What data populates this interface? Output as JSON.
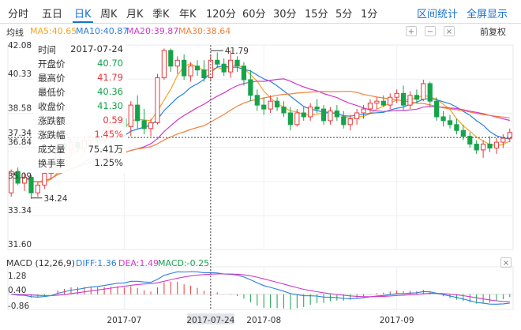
{
  "tabs": [
    {
      "label": "分时"
    },
    {
      "label": "五日"
    },
    {
      "label": "日K",
      "active": true
    },
    {
      "label": "周K"
    },
    {
      "label": "月K"
    },
    {
      "label": "季K"
    },
    {
      "label": "年K"
    },
    {
      "label": "120分"
    },
    {
      "label": "60分"
    },
    {
      "label": "30分"
    },
    {
      "label": "15分"
    },
    {
      "label": "5分"
    },
    {
      "label": "1分"
    }
  ],
  "toolbar": {
    "range_stats": "区间统计",
    "fullscreen": "全屏显示",
    "restore": "前复权"
  },
  "ma_legend": {
    "label": "均线",
    "ma5": "MA5:40.65",
    "ma10": "MA10:40.87",
    "ma20": "MA20:39.87",
    "ma30": "MA30:38.64"
  },
  "macd_legend": {
    "label": "MACD (12,26,9)",
    "diff": "DIFF:1.36",
    "dea": "DEA:1.49",
    "macd": "MACD:-0.25"
  },
  "controls": {
    "expand": "+",
    "collapse": "−",
    "close": "×"
  },
  "tooltip": {
    "rows": [
      {
        "label": "时间",
        "value": "2017-07-24"
      },
      {
        "label": "开盘价",
        "value": "40.70"
      },
      {
        "label": "最高价",
        "value": "41.79"
      },
      {
        "label": "最低价",
        "value": "40.36"
      },
      {
        "label": "收盘价",
        "value": "41.30"
      },
      {
        "label": "涨跌额",
        "value": "0.59"
      },
      {
        "label": "涨跌幅",
        "value": "1.45%"
      },
      {
        "label": "成交量",
        "value": "75.41万"
      },
      {
        "label": "换手率",
        "value": "1.25%"
      }
    ]
  },
  "colors": {
    "up": "#e4393c",
    "down": "#16a34a",
    "ma5": "#f5a623",
    "ma10": "#2a7fdc",
    "ma20": "#d13ac8",
    "ma30": "#f47f3b",
    "diff": "#2a7fdc",
    "dea": "#d13ac8",
    "accent": "#1a6fd1"
  },
  "chart_data": {
    "type": "candlestick",
    "y_ticks": [
      "42.08",
      "40.33",
      "38.58",
      "36.84",
      "35.09",
      "33.34",
      "31.60"
    ],
    "ylim": [
      31.6,
      42.08
    ],
    "x_ticks": [
      "2017-07",
      "2017-07-24",
      "2017-08",
      "2017-09"
    ],
    "crosshair": {
      "date": "2017-07-24",
      "price_label": "37.34",
      "high_label": "41.79"
    },
    "annotations": {
      "low": "34.24"
    },
    "candles": [
      [
        34.5,
        35.7,
        34.3,
        35.6
      ],
      [
        35.6,
        35.8,
        34.9,
        35.0
      ],
      [
        35.0,
        35.5,
        34.6,
        35.3
      ],
      [
        35.3,
        35.4,
        34.2,
        34.5
      ],
      [
        34.5,
        35.1,
        34.3,
        34.9
      ],
      [
        34.9,
        35.6,
        34.7,
        35.5
      ],
      [
        35.5,
        36.0,
        35.2,
        35.8
      ],
      [
        35.8,
        37.2,
        35.6,
        37.0
      ],
      [
        37.0,
        37.2,
        36.5,
        36.7
      ],
      [
        36.7,
        37.3,
        36.4,
        37.1
      ],
      [
        37.1,
        37.4,
        36.6,
        36.8
      ],
      [
        36.8,
        37.4,
        36.5,
        37.2
      ],
      [
        37.2,
        37.6,
        36.9,
        37.4
      ],
      [
        37.4,
        37.6,
        37.0,
        37.2
      ],
      [
        37.2,
        37.9,
        37.0,
        37.7
      ],
      [
        37.7,
        38.2,
        37.5,
        38.0
      ],
      [
        38.0,
        38.4,
        37.7,
        38.3
      ],
      [
        38.3,
        38.5,
        37.7,
        37.9
      ],
      [
        37.9,
        39.2,
        37.4,
        39.0
      ],
      [
        39.0,
        39.5,
        37.8,
        38.2
      ],
      [
        38.2,
        38.8,
        37.5,
        37.8
      ],
      [
        37.8,
        38.3,
        37.4,
        38.1
      ],
      [
        38.1,
        40.6,
        38.0,
        40.4
      ],
      [
        40.4,
        41.9,
        40.3,
        41.8
      ],
      [
        41.8,
        41.9,
        40.7,
        41.0
      ],
      [
        41.0,
        41.5,
        40.6,
        41.3
      ],
      [
        41.3,
        41.6,
        40.3,
        40.5
      ],
      [
        40.5,
        41.2,
        40.2,
        41.0
      ],
      [
        41.0,
        41.3,
        40.5,
        40.8
      ],
      [
        40.8,
        41.3,
        40.2,
        40.4
      ],
      [
        40.4,
        41.6,
        40.3,
        41.3
      ],
      [
        41.3,
        41.7,
        40.9,
        41.1
      ],
      [
        41.1,
        41.4,
        40.5,
        40.7
      ],
      [
        40.7,
        41.8,
        40.4,
        41.3
      ],
      [
        41.3,
        41.5,
        40.7,
        41.0
      ],
      [
        41.0,
        41.2,
        40.0,
        40.3
      ],
      [
        40.3,
        40.8,
        39.2,
        39.5
      ],
      [
        39.5,
        39.8,
        38.7,
        39.0
      ],
      [
        39.0,
        39.4,
        38.5,
        38.8
      ],
      [
        38.8,
        39.5,
        38.6,
        39.2
      ],
      [
        39.2,
        39.4,
        38.7,
        38.9
      ],
      [
        38.9,
        39.2,
        38.4,
        38.6
      ],
      [
        38.6,
        38.9,
        37.7,
        38.0
      ],
      [
        38.0,
        38.8,
        37.9,
        38.6
      ],
      [
        38.6,
        38.9,
        38.2,
        38.4
      ],
      [
        38.4,
        39.1,
        38.2,
        38.9
      ],
      [
        38.9,
        39.3,
        38.6,
        38.8
      ],
      [
        38.8,
        39.0,
        38.0,
        38.2
      ],
      [
        38.2,
        38.9,
        38.0,
        38.7
      ],
      [
        38.7,
        39.0,
        38.2,
        38.4
      ],
      [
        38.4,
        38.7,
        37.8,
        38.0
      ],
      [
        38.0,
        38.5,
        37.7,
        38.3
      ],
      [
        38.3,
        38.8,
        38.0,
        38.6
      ],
      [
        38.6,
        39.0,
        38.3,
        38.8
      ],
      [
        38.8,
        39.3,
        38.6,
        39.1
      ],
      [
        39.1,
        39.4,
        38.8,
        39.2
      ],
      [
        39.2,
        39.5,
        38.9,
        39.0
      ],
      [
        39.0,
        39.6,
        38.8,
        39.4
      ],
      [
        39.4,
        39.8,
        39.1,
        39.6
      ],
      [
        39.6,
        40.0,
        38.7,
        39.0
      ],
      [
        39.0,
        39.7,
        38.8,
        39.5
      ],
      [
        39.5,
        39.8,
        39.1,
        39.3
      ],
      [
        39.3,
        40.3,
        39.2,
        40.1
      ],
      [
        40.1,
        40.2,
        38.9,
        39.2
      ],
      [
        39.2,
        39.4,
        38.2,
        38.4
      ],
      [
        38.4,
        38.7,
        37.9,
        38.2
      ],
      [
        38.2,
        38.5,
        37.8,
        38.0
      ],
      [
        38.0,
        38.3,
        37.5,
        37.7
      ],
      [
        37.7,
        38.0,
        37.2,
        37.4
      ],
      [
        37.4,
        37.6,
        36.8,
        37.0
      ],
      [
        37.0,
        37.2,
        36.5,
        36.7
      ],
      [
        36.7,
        37.2,
        36.3,
        37.0
      ],
      [
        37.0,
        37.4,
        36.6,
        36.8
      ],
      [
        36.8,
        37.3,
        36.5,
        37.1
      ],
      [
        37.1,
        37.5,
        36.8,
        37.3
      ],
      [
        37.3,
        37.8,
        37.1,
        37.6
      ]
    ]
  }
}
